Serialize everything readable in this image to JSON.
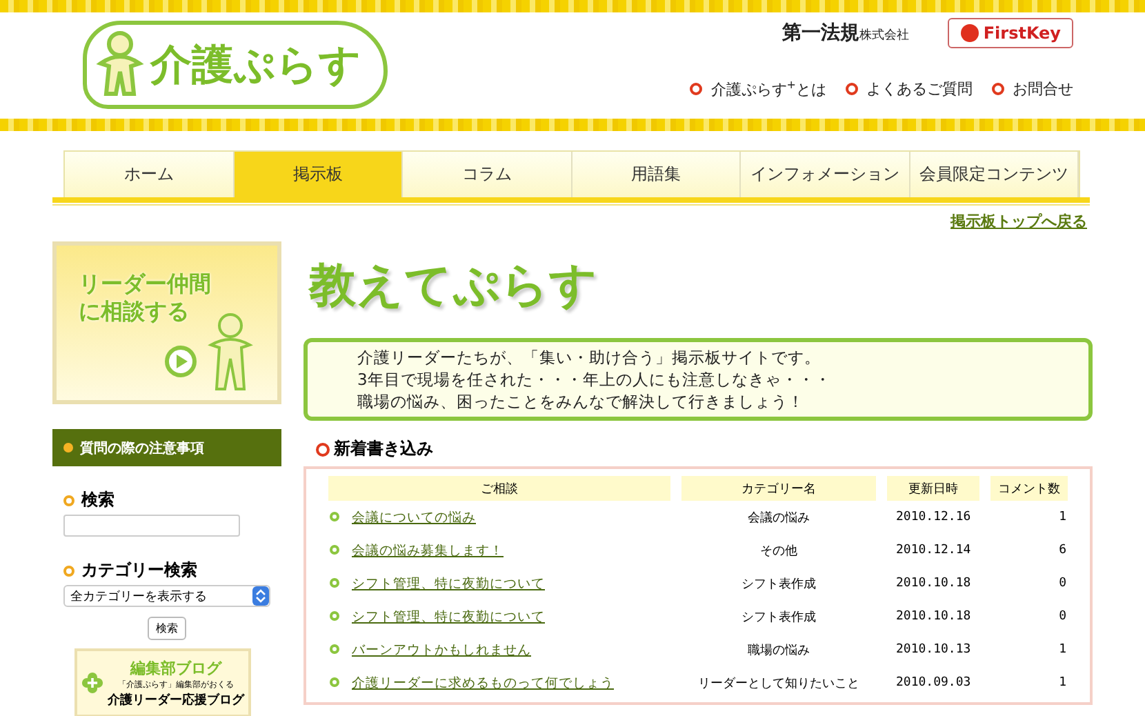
{
  "header": {
    "logo": "介護ぷらす",
    "publisher": "第一法規",
    "publisher_suffix": "株式会社",
    "partner": "FirstKey",
    "links": [
      "介護ぷらす$^{+}$とは",
      "よくあるご質問",
      "お問合せ"
    ]
  },
  "nav": [
    {
      "label": "ホーム",
      "selected": false
    },
    {
      "label": "掲示板",
      "selected": true
    },
    {
      "label": "コラム",
      "selected": false
    },
    {
      "label": "用語集",
      "selected": false
    },
    {
      "label": "インフォメーション",
      "selected": false
    },
    {
      "label": "会員限定コンテンツ",
      "selected": false
    }
  ],
  "back_link": "掲示板トップへ戻る",
  "sidebar": {
    "banner": "リーダー仲間に相談する",
    "notice": "質問の際の注意事項",
    "search_label": "検索",
    "category_label": "カテゴリー検索",
    "category_value": "全カテゴリーを表示する",
    "search_button": "検索",
    "blog": {
      "title": "編集部ブログ",
      "subtitle": "「介護ぷらす」編集部がおくる",
      "name": "介護リーダー応援ブログ"
    }
  },
  "main": {
    "title": "教えてぷらす",
    "intro": [
      "介護リーダーたちが、「集い・助け合う」掲示板サイトです。",
      "3年目で現場を任された・・・年上の人にも注意しなきゃ・・・",
      "職場の悩み、困ったことをみんなで解決して行きましょう！"
    ],
    "section": "新着書き込み",
    "table": {
      "columns": [
        "ご相談",
        "カテゴリー名",
        "更新日時",
        "コメント数"
      ],
      "rows": [
        [
          "会議についての悩み",
          "会議の悩み",
          "2010.12.16",
          "1"
        ],
        [
          "会議の悩み募集します！",
          "その他",
          "2010.12.14",
          "6"
        ],
        [
          "シフト管理、特に夜勤について",
          "シフト表作成",
          "2010.10.18",
          "0"
        ],
        [
          "シフト管理、特に夜勤について",
          "シフト表作成",
          "2010.10.18",
          "0"
        ],
        [
          "バーンアウトかもしれません",
          "職場の悩み",
          "2010.10.13",
          "1"
        ],
        [
          "介護リーダーに求めるものって何でしょう",
          "リーダーとして知りたいこと",
          "2010.09.03",
          "1"
        ]
      ]
    }
  }
}
